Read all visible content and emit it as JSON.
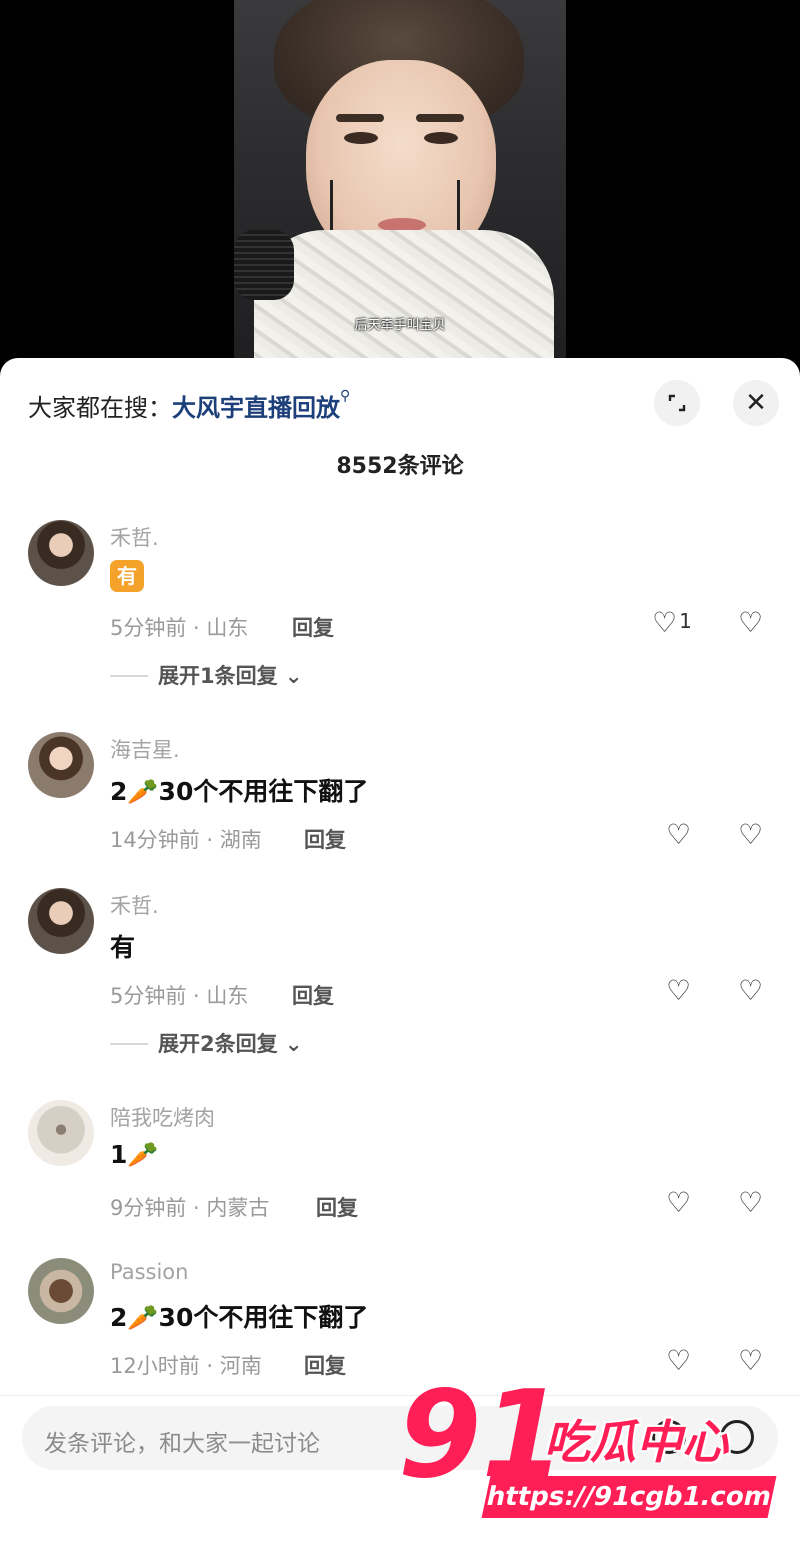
{
  "video": {
    "subtitle": "后天牵手叫宝贝"
  },
  "sheet": {
    "search_prefix": "大家都在搜：",
    "search_link": "大风宇直播回放",
    "expand_icon": "expand-icon",
    "close_icon": "close-icon",
    "comment_count": "8552条评论"
  },
  "comments": [
    {
      "user": "禾哲.",
      "text": "有",
      "badge": true,
      "time_loc": "5分钟前 · 山东",
      "reply": "回复",
      "likes": "1",
      "expand": "展开1条回复 ⌄"
    },
    {
      "user": "海吉星.",
      "text_pre": "2",
      "emoji": "🥕",
      "text_post": "30个不用往下翻了",
      "time_loc": "14分钟前 · 湖南",
      "reply": "回复",
      "likes": ""
    },
    {
      "user": "禾哲.",
      "text": "有",
      "time_loc": "5分钟前 · 山东",
      "reply": "回复",
      "likes": "",
      "expand": "展开2条回复 ⌄"
    },
    {
      "user": "陪我吃烤肉",
      "text_pre": "1",
      "emoji": "🥕",
      "text_post": "",
      "time_loc": "9分钟前 · 内蒙古",
      "reply": "回复",
      "likes": ""
    },
    {
      "user": "Passion",
      "text_pre": "2",
      "emoji": "🥕",
      "text_post": "30个不用往下翻了",
      "time_loc": "12小时前 · 河南",
      "reply": "回复",
      "likes": ""
    }
  ],
  "input": {
    "placeholder": "发条评论，和大家一起讨论"
  },
  "watermark": {
    "num_a": "9",
    "num_b": "1",
    "brand": "吃瓜中心",
    "url": "https://91cgb1.com"
  }
}
